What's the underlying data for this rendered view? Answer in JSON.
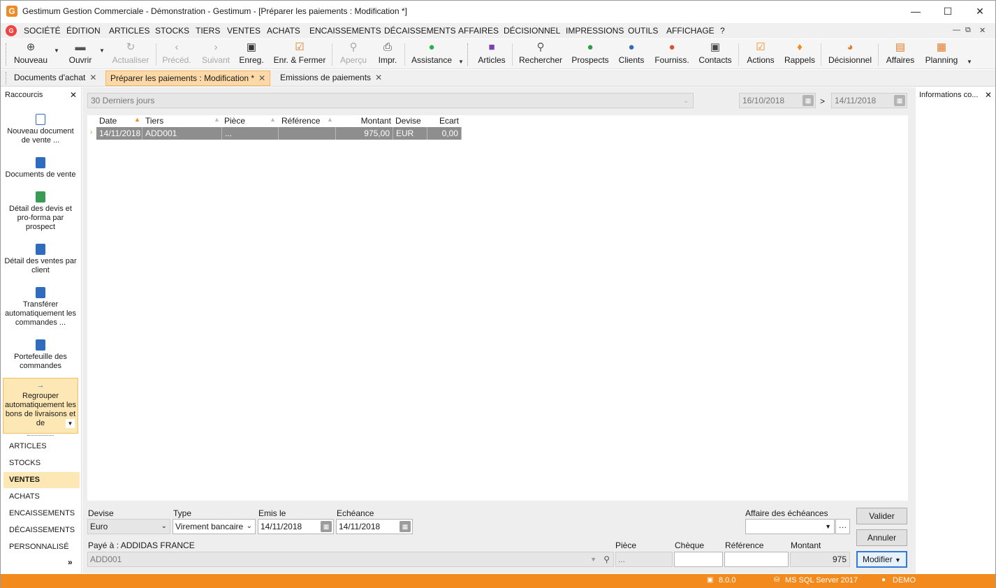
{
  "window": {
    "title": "Gestimum Gestion Commerciale - Démonstration - Gestimum - [Préparer les paiements : Modification *]",
    "app_icon": "G"
  },
  "menu": [
    "SOCIÉTÉ",
    "ÉDITION",
    "ARTICLES",
    "STOCKS",
    "TIERS",
    "VENTES",
    "ACHATS",
    "ENCAISSEMENTS",
    "DÉCAISSEMENTS",
    "AFFAIRES",
    "DÉCISIONNEL",
    "IMPRESSIONS",
    "OUTILS",
    "AFFICHAGE",
    "?"
  ],
  "toolbar": {
    "new": "Nouveau",
    "open": "Ouvrir",
    "refresh": "Actualiser",
    "prev": "Précéd.",
    "next": "Suivant",
    "save": "Enreg.",
    "save_close": "Enr. & Fermer",
    "preview": "Aperçu",
    "print": "Impr.",
    "assist": "Assistance",
    "articles": "Articles",
    "search": "Rechercher",
    "prospects": "Prospects",
    "clients": "Clients",
    "suppliers": "Fourniss.",
    "contacts": "Contacts",
    "actions": "Actions",
    "reminders": "Rappels",
    "bi": "Décisionnel",
    "business": "Affaires",
    "planning": "Planning"
  },
  "tabs": [
    {
      "label": "Documents d'achat"
    },
    {
      "label": "Préparer les paiements : Modification *"
    },
    {
      "label": "Emissions de paiements"
    }
  ],
  "sidebar": {
    "title": "Raccourcis",
    "shortcuts": [
      "Nouveau document de vente ...",
      "Documents de vente",
      "Détail des devis et pro-forma par prospect",
      "Détail des ventes par client",
      "Transférer automatiquement les commandes ...",
      "Portefeuille des commandes",
      "Regrouper automatiquement les bons de livraisons et de"
    ],
    "sections": [
      "ARTICLES",
      "STOCKS",
      "VENTES",
      "ACHATS",
      "ENCAISSEMENTS",
      "DÉCAISSEMENTS",
      "PERSONNALISÉ"
    ],
    "more": "»"
  },
  "filter": {
    "period": "30 Derniers jours",
    "date_from": "16/10/2018",
    "sep": ">",
    "date_to": "14/11/2018"
  },
  "grid": {
    "columns": [
      "Date",
      "Tiers",
      "Pièce",
      "Référence",
      "Montant",
      "Devise",
      "Ecart"
    ],
    "rows": [
      {
        "date": "14/11/2018",
        "tiers": "ADD001",
        "piece": "...",
        "reference": "",
        "montant": "975,00",
        "devise": "EUR",
        "ecart": "0,00"
      }
    ]
  },
  "form": {
    "devise_label": "Devise",
    "devise": "Euro",
    "type_label": "Type",
    "type": "Virement bancaire",
    "emis_label": "Emis le",
    "emis": "14/11/2018",
    "echeance_label": "Echéance",
    "echeance": "14/11/2018",
    "affaire_label": "Affaire des échéances",
    "affaire": "",
    "paye_label": "Payé à  : ADDIDAS FRANCE",
    "paye": "ADD001",
    "piece_label": "Pièce",
    "piece": "...",
    "cheque_label": "Chèque",
    "cheque": "",
    "reference_label": "Référence",
    "reference": "",
    "montant_label": "Montant",
    "montant": "975"
  },
  "buttons": {
    "validate": "Valider",
    "cancel": "Annuler",
    "modify": "Modifier"
  },
  "right_panel": {
    "title": "Informations co..."
  },
  "status": {
    "version": "8.0.0",
    "db": "MS SQL Server 2017",
    "user": "DEMO"
  },
  "colors": {
    "accent": "#f28a1d",
    "tab_active": "#fcd9a6",
    "selection": "#8e8e8e"
  }
}
